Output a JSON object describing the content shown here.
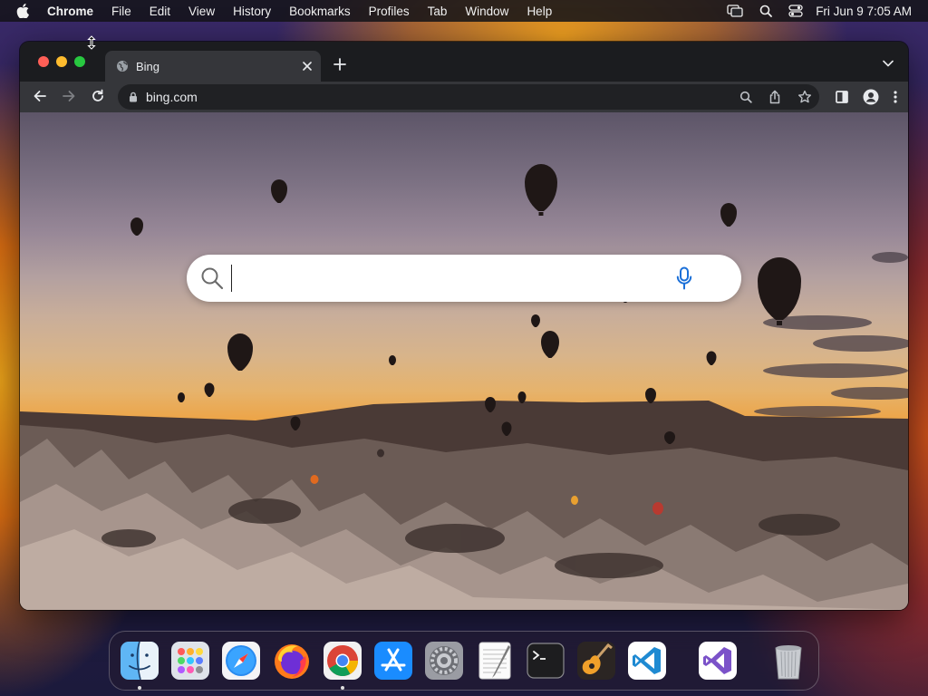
{
  "menubar": {
    "app_name": "Chrome",
    "menus": [
      "File",
      "Edit",
      "View",
      "History",
      "Bookmarks",
      "Profiles",
      "Tab",
      "Window",
      "Help"
    ],
    "clock": "Fri Jun 9  7:05 AM"
  },
  "browser": {
    "tab_title": "Bing",
    "url": "bing.com"
  },
  "page": {
    "search_value": ""
  },
  "dock": {
    "apps": [
      "Finder",
      "Launchpad",
      "Safari",
      "Firefox",
      "Google Chrome",
      "App Store",
      "System Settings",
      "TextEdit",
      "Terminal",
      "GarageBand",
      "Visual Studio Code",
      "Visual Studio",
      "Trash"
    ]
  }
}
